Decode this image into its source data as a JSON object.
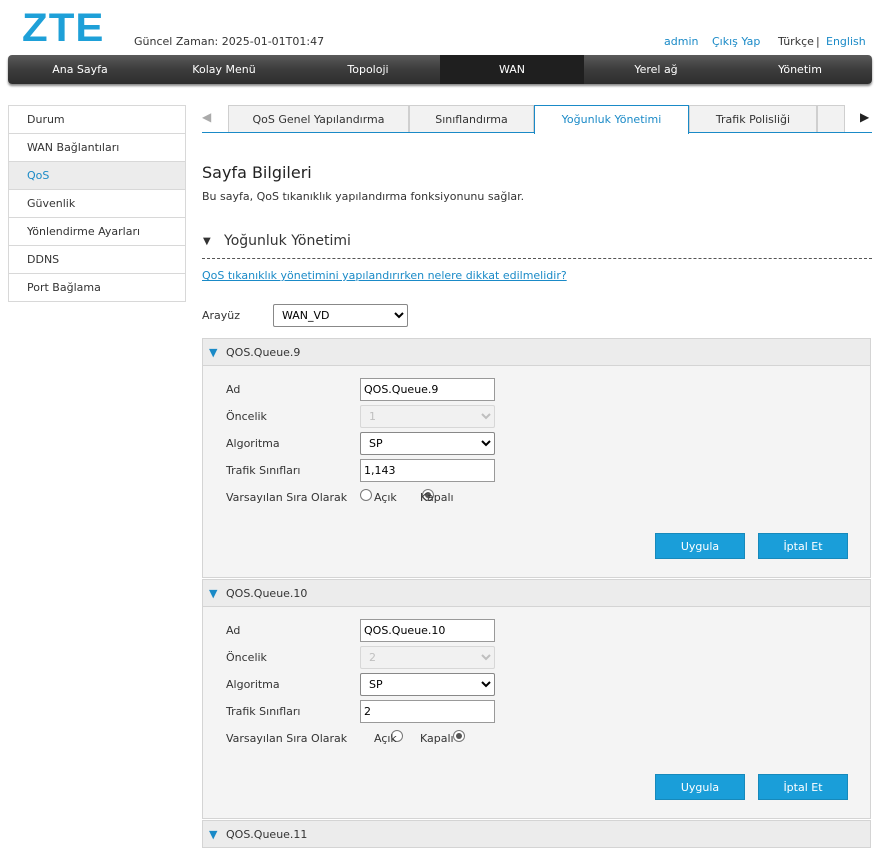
{
  "header": {
    "logo": "ZTE",
    "time_label": "Güncel Zaman: 2025-01-01T01:47",
    "admin": "admin",
    "logout": "Çıkış Yap",
    "lang_tr": "Türkçe",
    "lang_sep": "|",
    "lang_en": "English"
  },
  "nav": [
    "Ana Sayfa",
    "Kolay Menü",
    "Topoloji",
    "WAN",
    "Yerel ağ",
    "Yönetim"
  ],
  "sidebar": [
    "Durum",
    "WAN Bağlantıları",
    "QoS",
    "Güvenlik",
    "Yönlendirme Ayarları",
    "DDNS",
    "Port Bağlama"
  ],
  "tabs": {
    "left_arrow": "◀",
    "right_arrow": "▶",
    "items": [
      "QoS Genel Yapılandırma",
      "Sınıflandırma",
      "Yoğunluk Yönetimi",
      "Trafik Polisliği"
    ]
  },
  "page": {
    "title": "Sayfa Bilgileri",
    "desc": "Bu sayfa, QoS tıkanıklık yapılandırma fonksiyonunu sağlar.",
    "section": "Yoğunluk Yönetimi",
    "help": "QoS tıkanıklık yönetimini yapılandırırken nelere dikkat edilmelidir?",
    "interface_label": "Arayüz",
    "interface_value": "WAN_VD"
  },
  "labels": {
    "name": "Ad",
    "priority": "Öncelik",
    "algorithm": "Algoritma",
    "traffic": "Trafik Sınıfları",
    "default": "Varsayılan Sıra Olarak",
    "on": "Açık",
    "off": "Kapalı",
    "apply": "Uygula",
    "cancel": "İptal Et"
  },
  "queues": [
    {
      "title": "QOS.Queue.9",
      "name": "QOS.Queue.9",
      "priority": "1",
      "algorithm": "SP",
      "traffic": "1,143"
    },
    {
      "title": "QOS.Queue.10",
      "name": "QOS.Queue.10",
      "priority": "2",
      "algorithm": "SP",
      "traffic": "2"
    },
    {
      "title": "QOS.Queue.11"
    }
  ],
  "colors": {
    "accent": "#1a9ed9",
    "logo": "#1ea0d8"
  }
}
